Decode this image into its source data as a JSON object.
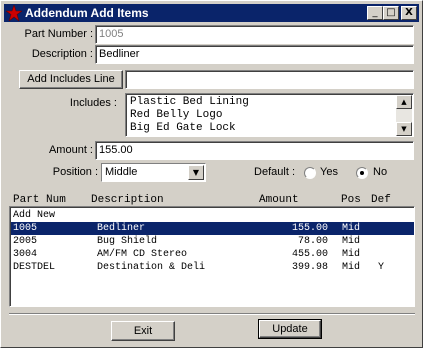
{
  "window": {
    "title": "Addendum Add Items",
    "minimize_glyph": "_",
    "maximize_glyph": "□",
    "close_glyph": "X",
    "titlebar_color": "#0a246a",
    "icon_color": "#cc0000"
  },
  "form": {
    "part_number_label": "Part Number :",
    "part_number_value": "1005",
    "description_label": "Description :",
    "description_value": "Bedliner",
    "add_includes_button": "Add Includes Line",
    "add_includes_value": "",
    "includes_label": "Includes :",
    "includes_lines": [
      "Plastic Bed Lining",
      "Red Belly Logo",
      "Big Ed Gate Lock"
    ],
    "amount_label": "Amount :",
    "amount_value": "155.00",
    "position_label": "Position :",
    "position_value": "Middle",
    "default_label": "Default :",
    "default_yes": "Yes",
    "default_no": "No",
    "default_selected": "No"
  },
  "list": {
    "headers": [
      "Part Num",
      "Description",
      "Amount",
      "Pos",
      "Def"
    ],
    "rows": [
      {
        "part": "Add New",
        "desc": "",
        "amount": "",
        "pos": "",
        "def": "",
        "selected": false
      },
      {
        "part": "1005",
        "desc": "Bedliner",
        "amount": "155.00",
        "pos": "Mid",
        "def": "",
        "selected": true
      },
      {
        "part": "2005",
        "desc": "Bug Shield",
        "amount": "78.00",
        "pos": "Mid",
        "def": "",
        "selected": false
      },
      {
        "part": "3004",
        "desc": "AM/FM CD Stereo",
        "amount": "455.00",
        "pos": "Mid",
        "def": "",
        "selected": false
      },
      {
        "part": "DESTDEL",
        "desc": "Destination & Deli",
        "amount": "399.98",
        "pos": "Mid",
        "def": "Y",
        "selected": false
      }
    ],
    "selection_color": "#0a246a"
  },
  "footer": {
    "exit_button": "Exit",
    "update_button": "Update"
  }
}
